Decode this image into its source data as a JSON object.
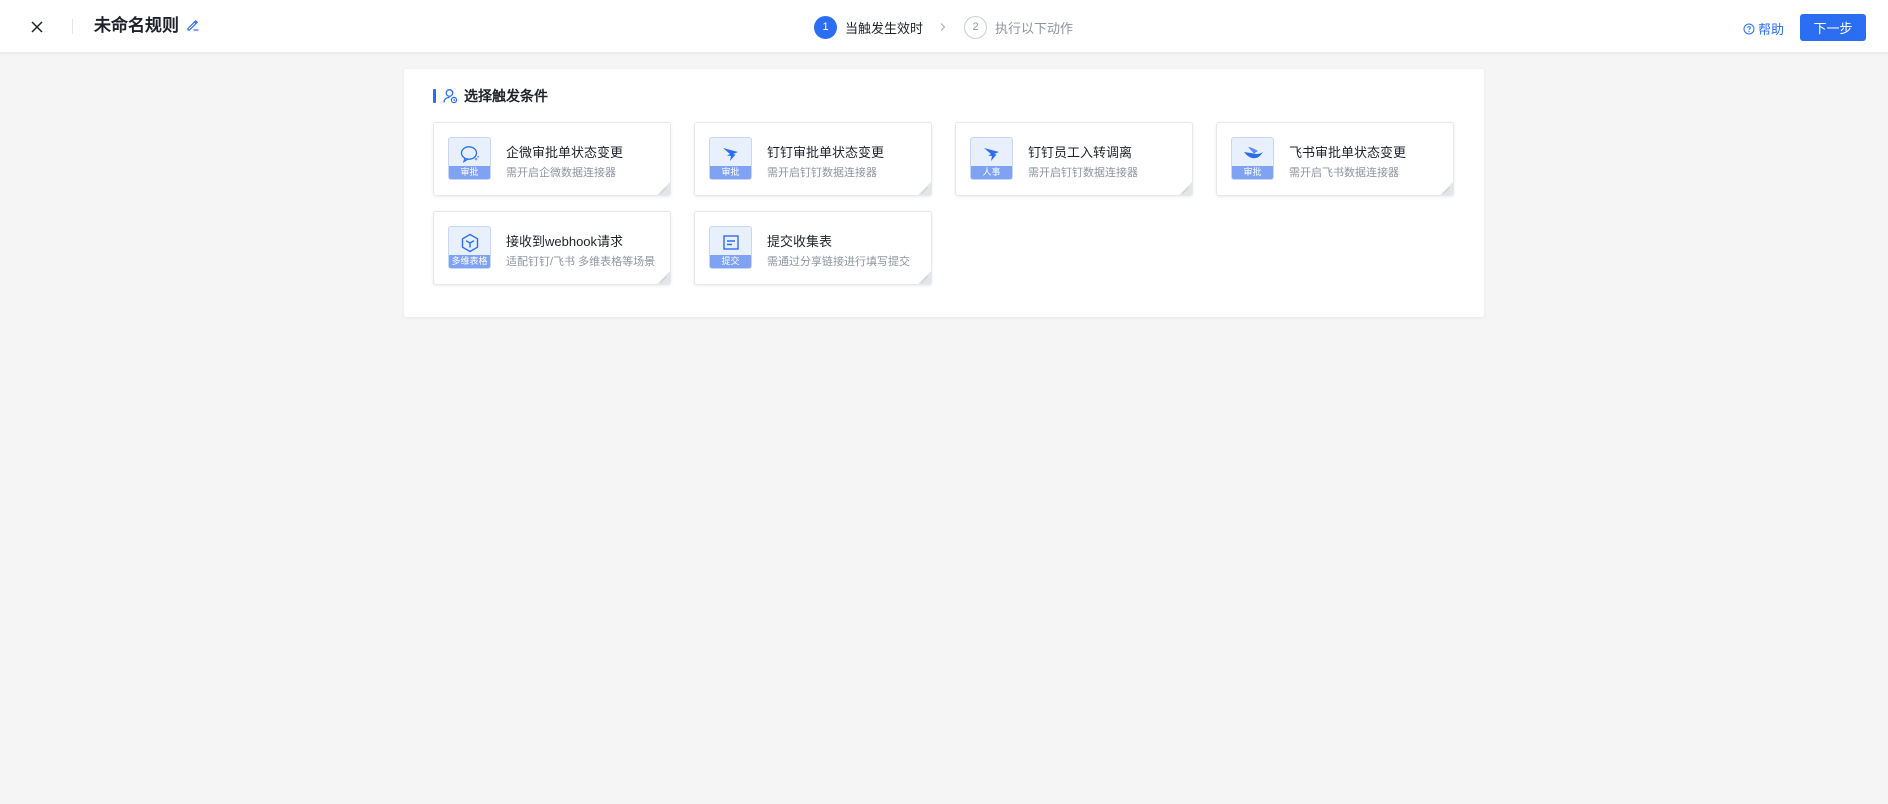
{
  "header": {
    "title": "未命名规则",
    "steps": [
      {
        "number": "1",
        "label": "当触发生效时"
      },
      {
        "number": "2",
        "label": "执行以下动作"
      }
    ],
    "help_label": "帮助",
    "next_label": "下一步"
  },
  "panel": {
    "section_title": "选择触发条件",
    "cards": [
      {
        "title": "企微审批单状态变更",
        "subtitle": "需开启企微数据连接器",
        "tag": "审批",
        "icon": "wecom-chat-icon"
      },
      {
        "title": "钉钉审批单状态变更",
        "subtitle": "需开启钉钉数据连接器",
        "tag": "审批",
        "icon": "dingtalk-icon"
      },
      {
        "title": "钉钉员工入转调离",
        "subtitle": "需开启钉钉数据连接器",
        "tag": "人事",
        "icon": "dingtalk-icon"
      },
      {
        "title": "飞书审批单状态变更",
        "subtitle": "需开启飞书数据连接器",
        "tag": "审批",
        "icon": "feishu-icon"
      },
      {
        "title": "接收到webhook请求",
        "subtitle": "适配钉钉/飞书 多维表格等场景",
        "tag": "多维表格",
        "icon": "cube-icon"
      },
      {
        "title": "提交收集表",
        "subtitle": "需通过分享链接进行填写提交",
        "tag": "提交",
        "icon": "form-icon"
      }
    ]
  },
  "colors": {
    "accent": "#2b6ef4",
    "tag_bg": "#7fa3f2",
    "icon_bg": "#e8effd",
    "page_bg": "#f5f5f6"
  }
}
